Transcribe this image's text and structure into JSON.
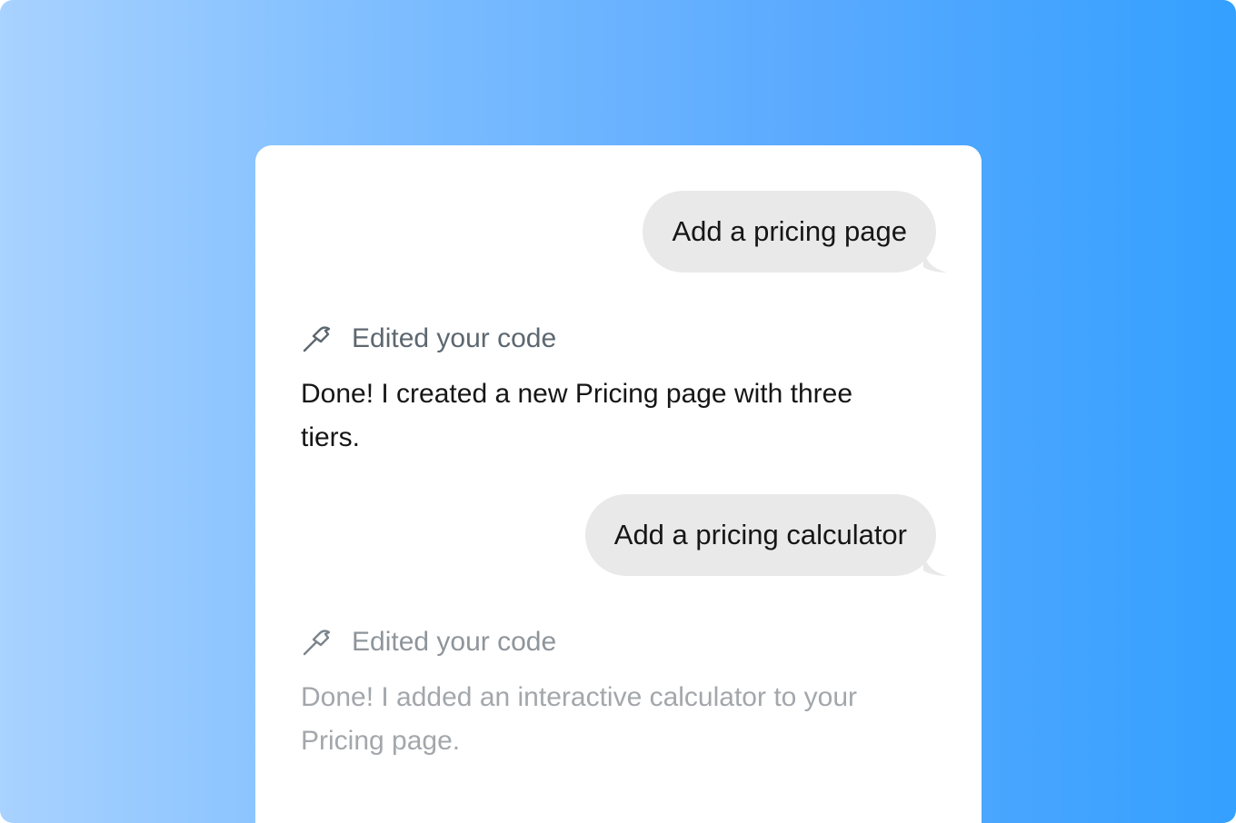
{
  "conversation": {
    "messages": [
      {
        "role": "user",
        "text": "Add a pricing page"
      },
      {
        "role": "assistant",
        "status": "Edited your code",
        "status_icon": "hammer-icon",
        "text": "Done! I created a new Pricing page with three tiers."
      },
      {
        "role": "user",
        "text": "Add a pricing calculator"
      },
      {
        "role": "assistant",
        "status": "Edited your code",
        "status_icon": "hammer-icon",
        "text": "Done! I added an interactive calculator to your Pricing page."
      }
    ]
  },
  "colors": {
    "bubble_background": "#e9e9e9",
    "text_primary": "#161616",
    "status_text": "#5d6770",
    "faded_text": "#a3a7ab",
    "gradient_start": "#a8d2ff",
    "gradient_end": "#34a0ff"
  }
}
